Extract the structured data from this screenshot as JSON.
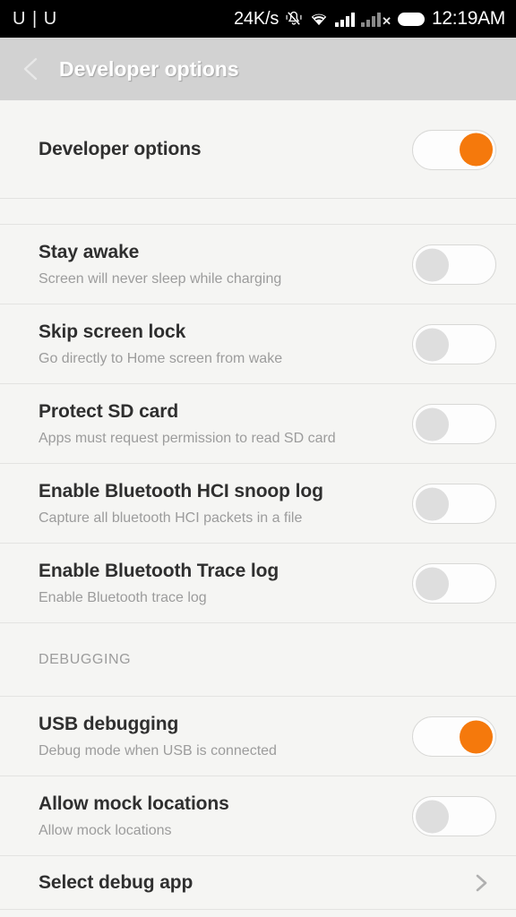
{
  "status_bar": {
    "carrier": "U | U",
    "network_speed": "24K/s",
    "time": "12:19AM",
    "icons": [
      "vibrate-off-icon",
      "wifi-icon",
      "signal-bars-icon",
      "signal-no-service-icon",
      "battery-full-icon"
    ]
  },
  "app_bar": {
    "back_label": "back-chevron",
    "title": "Developer options"
  },
  "master": {
    "title": "Developer options",
    "toggle_state": "on"
  },
  "colors": {
    "accent_orange": "#f5790c",
    "toggle_off_knob": "#dedede",
    "appbar_bg": "#d2d2d2",
    "content_bg": "#f5f5f3",
    "title_text": "#2f2f2f",
    "sub_text": "#9c9c9c",
    "statusbar_bg": "#000000"
  },
  "sections": [
    {
      "label": "",
      "rows": [
        {
          "title": "Stay awake",
          "subtitle": "Screen will never sleep while charging",
          "control": "toggle",
          "state": "off"
        },
        {
          "title": "Skip screen lock",
          "subtitle": "Go directly to Home screen from wake",
          "control": "toggle",
          "state": "off"
        },
        {
          "title": "Protect SD card",
          "subtitle": "Apps must request permission to read SD card",
          "control": "toggle",
          "state": "off"
        },
        {
          "title": "Enable Bluetooth HCI snoop log",
          "subtitle": "Capture all bluetooth HCI packets in a file",
          "control": "toggle",
          "state": "off"
        },
        {
          "title": "Enable Bluetooth Trace log",
          "subtitle": "Enable Bluetooth trace log",
          "control": "toggle",
          "state": "off"
        }
      ]
    },
    {
      "label": "DEBUGGING",
      "rows": [
        {
          "title": "USB debugging",
          "subtitle": "Debug mode when USB is connected",
          "control": "toggle",
          "state": "on"
        },
        {
          "title": "Allow mock locations",
          "subtitle": "Allow mock locations",
          "control": "toggle",
          "state": "off"
        },
        {
          "title": "Select debug app",
          "subtitle": "",
          "control": "chevron",
          "state": ""
        }
      ]
    }
  ]
}
